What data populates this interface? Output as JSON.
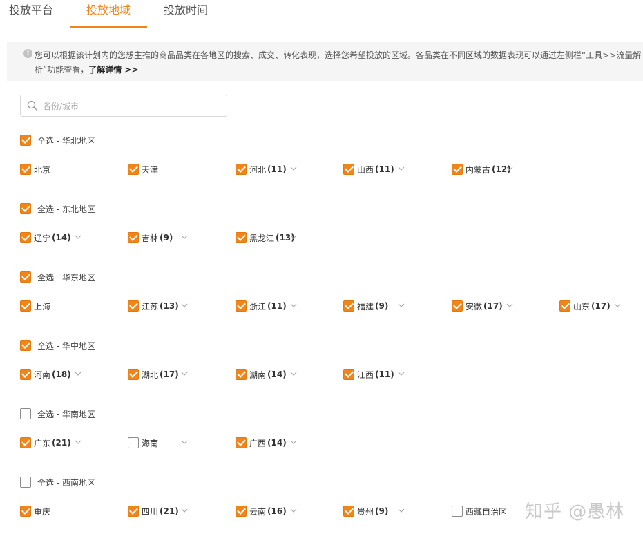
{
  "tabs": [
    {
      "label": "投放平台",
      "active": false
    },
    {
      "label": "投放地域",
      "active": true
    },
    {
      "label": "投放时间",
      "active": false
    }
  ],
  "accent_color": "#f08519",
  "notice": {
    "icon": "info-icon",
    "text": "您可以根据该计划内的您想主推的商品品类在各地区的搜索、成交、转化表现，选择您希望投放的区域。各品类在不同区域的数据表现可以通过左侧栏“工具>>流量解析”功能查看，",
    "link": "了解详情 >>"
  },
  "search": {
    "placeholder": "省份/城市",
    "value": ""
  },
  "regions": [
    {
      "label": "全选 - 华北地区",
      "checked": true,
      "provinces": [
        {
          "name": "北京",
          "count": "",
          "checked": true,
          "expandable": false
        },
        {
          "name": "天津",
          "count": "",
          "checked": true,
          "expandable": false
        },
        {
          "name": "河北",
          "count": "(11)",
          "checked": true,
          "expandable": true
        },
        {
          "name": "山西",
          "count": "(11)",
          "checked": true,
          "expandable": true
        },
        {
          "name": "内蒙古",
          "count": "(12)",
          "checked": true,
          "expandable": true
        }
      ]
    },
    {
      "label": "全选 - 东北地区",
      "checked": true,
      "provinces": [
        {
          "name": "辽宁",
          "count": "(14)",
          "checked": true,
          "expandable": true
        },
        {
          "name": "吉林",
          "count": "(9)",
          "checked": true,
          "expandable": true
        },
        {
          "name": "黑龙江",
          "count": "(13)",
          "checked": true,
          "expandable": true
        }
      ]
    },
    {
      "label": "全选 - 华东地区",
      "checked": true,
      "provinces": [
        {
          "name": "上海",
          "count": "",
          "checked": true,
          "expandable": false
        },
        {
          "name": "江苏",
          "count": "(13)",
          "checked": true,
          "expandable": true
        },
        {
          "name": "浙江",
          "count": "(11)",
          "checked": true,
          "expandable": true
        },
        {
          "name": "福建",
          "count": "(9)",
          "checked": true,
          "expandable": true
        },
        {
          "name": "安徽",
          "count": "(17)",
          "checked": true,
          "expandable": true
        },
        {
          "name": "山东",
          "count": "(17)",
          "checked": true,
          "expandable": true
        }
      ]
    },
    {
      "label": "全选 - 华中地区",
      "checked": true,
      "provinces": [
        {
          "name": "河南",
          "count": "(18)",
          "checked": true,
          "expandable": true
        },
        {
          "name": "湖北",
          "count": "(17)",
          "checked": true,
          "expandable": true
        },
        {
          "name": "湖南",
          "count": "(14)",
          "checked": true,
          "expandable": true
        },
        {
          "name": "江西",
          "count": "(11)",
          "checked": true,
          "expandable": true
        }
      ]
    },
    {
      "label": "全选 - 华南地区",
      "checked": false,
      "provinces": [
        {
          "name": "广东",
          "count": "(21)",
          "checked": true,
          "expandable": true
        },
        {
          "name": "海南",
          "count": "",
          "checked": false,
          "expandable": true
        },
        {
          "name": "广西",
          "count": "(14)",
          "checked": true,
          "expandable": true
        }
      ]
    },
    {
      "label": "全选 - 西南地区",
      "checked": false,
      "provinces": [
        {
          "name": "重庆",
          "count": "",
          "checked": true,
          "expandable": false
        },
        {
          "name": "四川",
          "count": "(21)",
          "checked": true,
          "expandable": true
        },
        {
          "name": "云南",
          "count": "(16)",
          "checked": true,
          "expandable": true
        },
        {
          "name": "贵州",
          "count": "(9)",
          "checked": true,
          "expandable": true
        },
        {
          "name": "西藏自治区",
          "count": "",
          "checked": false,
          "expandable": false
        }
      ]
    }
  ],
  "watermark": "知乎 @愚林"
}
